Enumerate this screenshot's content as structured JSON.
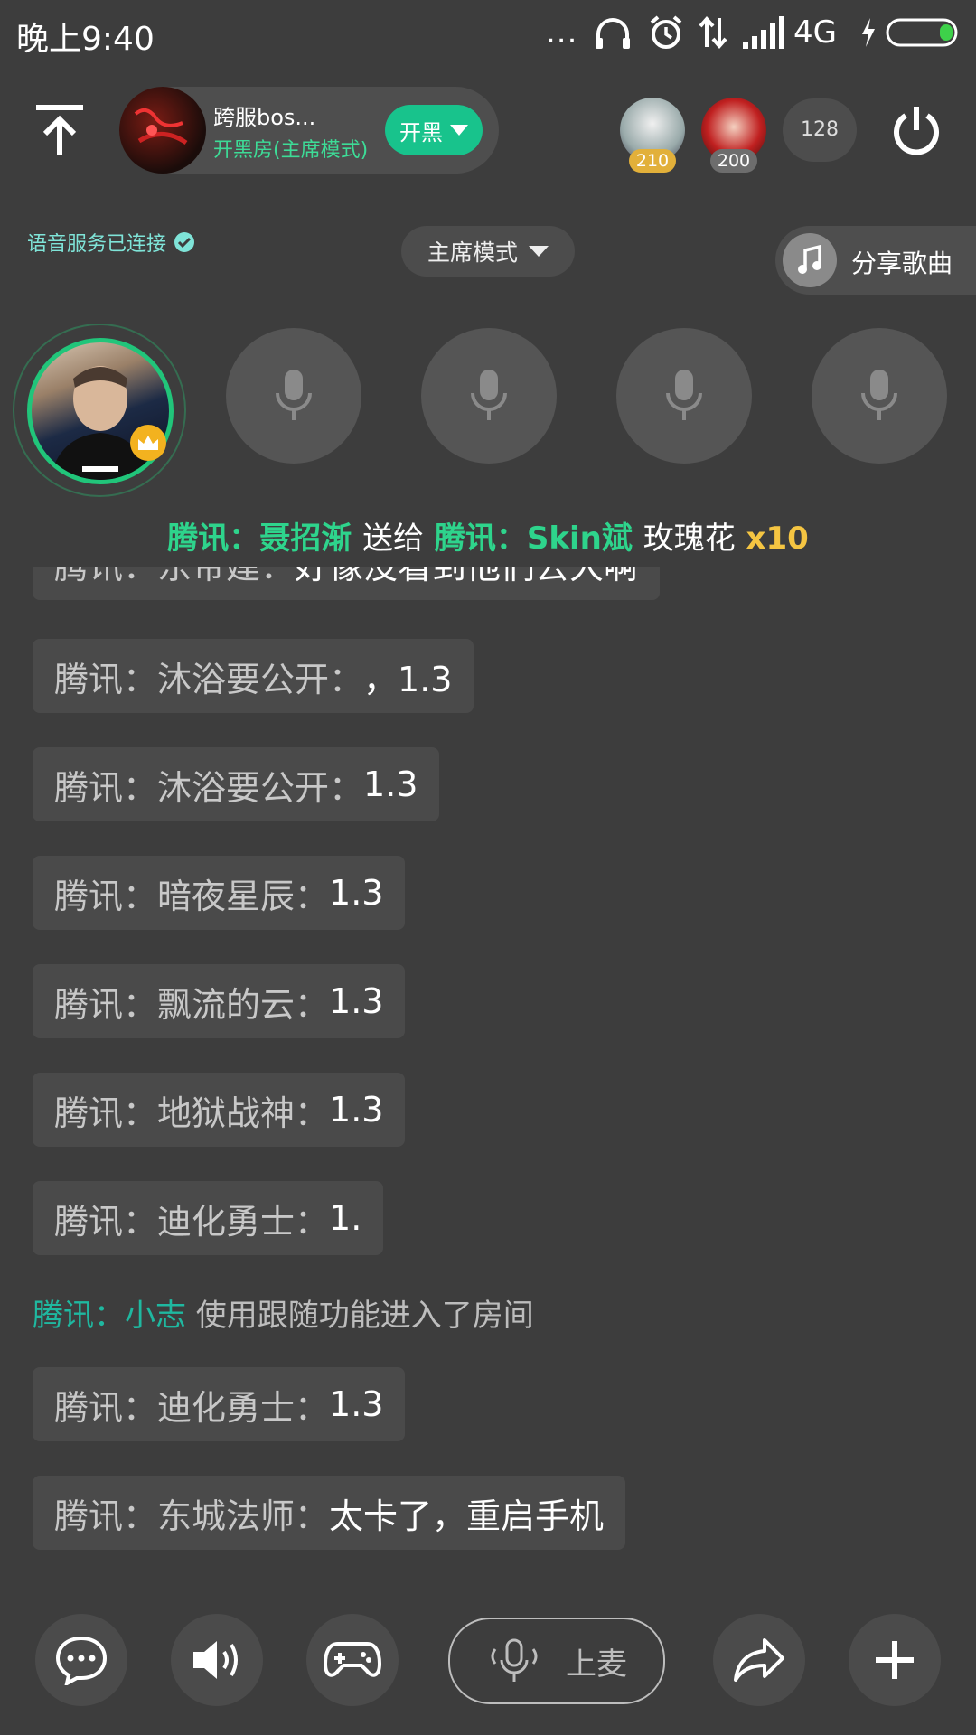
{
  "status_bar": {
    "time": "晚上9:40",
    "network": "4G",
    "dots": "..."
  },
  "header": {
    "room_name": "跨服bos...",
    "room_mode": "开黑房(主席模式)",
    "kaihei_label": "开黑",
    "top_users": [
      {
        "score": "210"
      },
      {
        "score": "200"
      }
    ],
    "online_count": "128"
  },
  "row2": {
    "voice_status": "语音服务已连接",
    "mode_select": "主席模式",
    "share_song": "分享歌曲"
  },
  "gift": {
    "sender": "腾讯：聂招渐",
    "verb": "送给",
    "receiver": "腾讯：Skin斌",
    "item": "玫瑰花",
    "count": "x10"
  },
  "chat": {
    "partial_top": {
      "prefix": "腾讯：东帝建：",
      "text": "好像没看到他们去大啊"
    },
    "messages": [
      {
        "prefix": "腾讯：沐浴要公开：",
        "text": "，1.3"
      },
      {
        "prefix": "腾讯：沐浴要公开：",
        "text": "1.3"
      },
      {
        "prefix": "腾讯：暗夜星辰：",
        "text": "1.3"
      },
      {
        "prefix": "腾讯：飘流的云：",
        "text": "1.3"
      },
      {
        "prefix": "腾讯：地狱战神：",
        "text": "1.3"
      },
      {
        "prefix": "腾讯：迪化勇士：",
        "text": "1."
      }
    ],
    "system": {
      "user": "腾讯：小志",
      "text": " 使用跟随功能进入了房间"
    },
    "messages_after": [
      {
        "prefix": "腾讯：迪化勇士：",
        "text": "1.3"
      },
      {
        "prefix": "腾讯：东城法师：",
        "text": "太卡了，重启手机"
      }
    ]
  },
  "bottom_bar": {
    "mic_up_label": "上麦"
  },
  "colors": {
    "accent": "#18c38c",
    "gift_green": "#2ed48c",
    "gift_yellow": "#f5c542",
    "system_teal": "#1fb8a0"
  }
}
